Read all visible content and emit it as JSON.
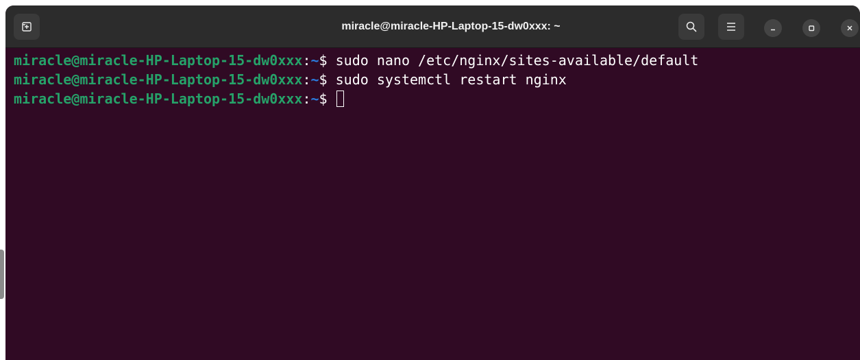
{
  "window": {
    "title": "miracle@miracle-HP-Laptop-15-dw0xxx: ~",
    "icons": {
      "new_tab": "new-tab-icon",
      "search": "search-icon",
      "menu": "hamburger-menu-icon",
      "minimize": "minimize-icon",
      "maximize": "maximize-icon",
      "close": "close-icon"
    }
  },
  "terminal": {
    "colors": {
      "background": "#300a24",
      "prompt_user": "#26a269",
      "prompt_path": "#2a7bde",
      "text": "#ffffff"
    },
    "lines": [
      {
        "user_host": "miracle@miracle-HP-Laptop-15-dw0xxx",
        "separator": ":",
        "path": "~",
        "symbol": "$ ",
        "command": "sudo nano /etc/nginx/sites-available/default"
      },
      {
        "user_host": "miracle@miracle-HP-Laptop-15-dw0xxx",
        "separator": ":",
        "path": "~",
        "symbol": "$ ",
        "command": "sudo systemctl restart nginx"
      },
      {
        "user_host": "miracle@miracle-HP-Laptop-15-dw0xxx",
        "separator": ":",
        "path": "~",
        "symbol": "$ ",
        "command": ""
      }
    ]
  }
}
